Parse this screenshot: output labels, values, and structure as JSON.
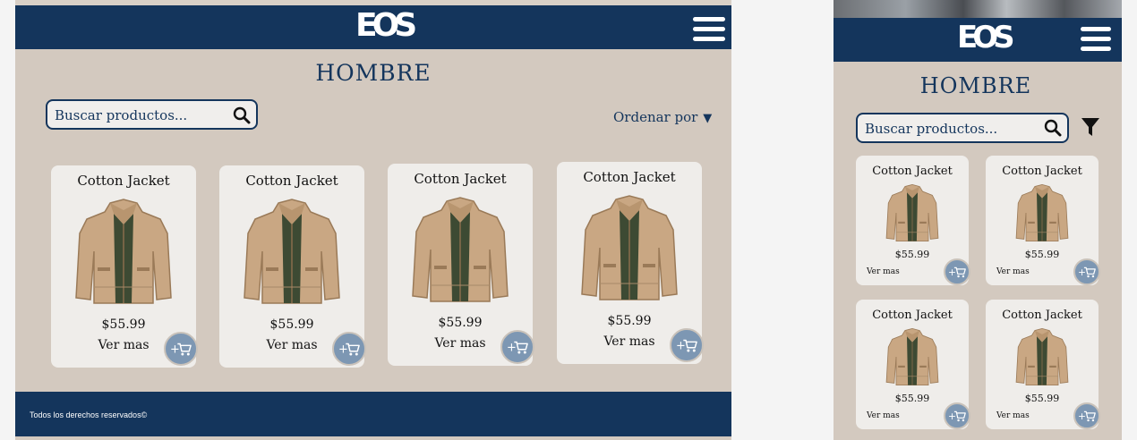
{
  "colors": {
    "navy": "#14355c",
    "beige": "#d3c9bf",
    "card": "#efedea",
    "cart_button": "#7d97b3"
  },
  "logo": {
    "text": "EOS"
  },
  "page": {
    "title": "HOMBRE"
  },
  "search": {
    "placeholder": "Buscar productos..."
  },
  "sort": {
    "label": "Ordenar por",
    "arrow": "▼"
  },
  "footer": {
    "text": "Todos los derechos reservados©"
  },
  "products": [
    {
      "name": "Cotton Jacket",
      "price": "$55.99",
      "more": "Ver mas"
    },
    {
      "name": "Cotton Jacket",
      "price": "$55.99",
      "more": "Ver mas"
    },
    {
      "name": "Cotton Jacket",
      "price": "$55.99",
      "more": "Ver mas"
    },
    {
      "name": "Cotton Jacket",
      "price": "$55.99",
      "more": "Ver mas"
    }
  ],
  "mobile_products": [
    {
      "name": "Cotton Jacket",
      "price": "$55.99",
      "more": "Ver mas"
    },
    {
      "name": "Cotton Jacket",
      "price": "$55.99",
      "more": "Ver mas"
    },
    {
      "name": "Cotton Jacket",
      "price": "$55.99",
      "more": "Ver mas"
    },
    {
      "name": "Cotton Jacket",
      "price": "$55.99",
      "more": "Ver mas"
    }
  ],
  "icons": {
    "search": "search-icon",
    "cart": "add-to-cart-icon",
    "menu": "hamburger-menu-icon",
    "filter": "filter-icon"
  }
}
